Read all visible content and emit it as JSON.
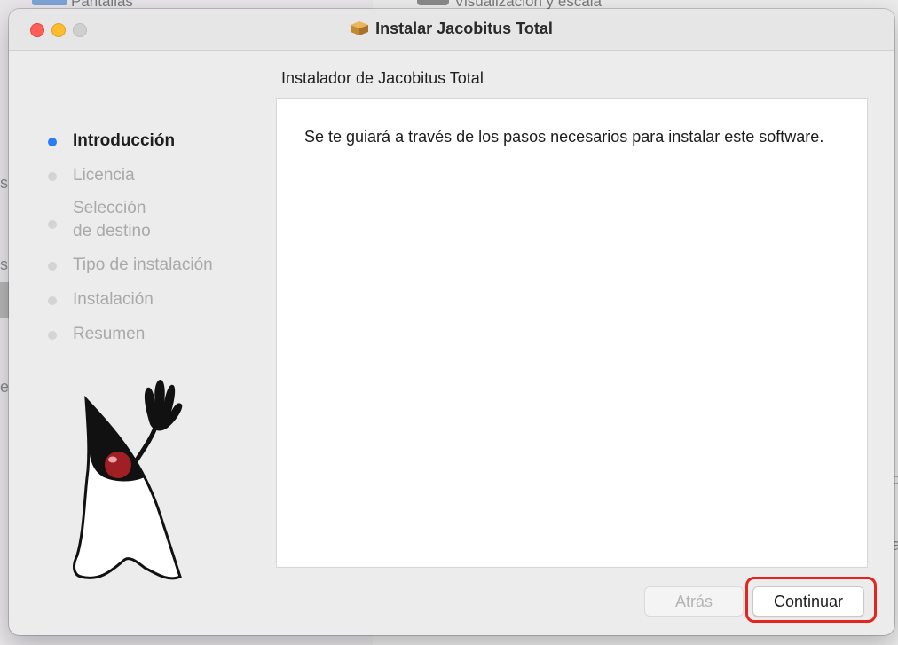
{
  "background": {
    "top_left_text": "Pantallas",
    "top_right_text": "Visualización y escala",
    "edge_letters": [
      "s",
      "s",
      "e",
      "c",
      "a"
    ]
  },
  "window": {
    "title": "Instalar Jacobitus Total",
    "subtitle": "Instalador de Jacobitus Total"
  },
  "steps": [
    {
      "label": "Introducción",
      "active": true
    },
    {
      "label": "Licencia",
      "active": false
    },
    {
      "label": "Selección\nde destino",
      "active": false
    },
    {
      "label": "Tipo de instalación",
      "active": false
    },
    {
      "label": "Instalación",
      "active": false
    },
    {
      "label": "Resumen",
      "active": false
    }
  ],
  "panel": {
    "text": "Se te guiará a través de los pasos necesarios para instalar este software."
  },
  "buttons": {
    "back": "Atrás",
    "continue": "Continuar"
  },
  "colors": {
    "accent": "#2a7bf6",
    "highlight": "#e3241f"
  }
}
